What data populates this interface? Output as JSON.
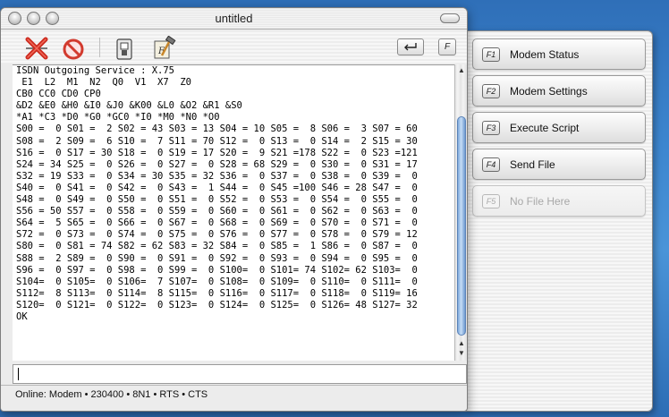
{
  "window": {
    "title": "untitled",
    "toolbar": {
      "disconnect_icon": "red-x-disconnect-icon",
      "stop_icon": "no-entry-icon",
      "settings_icon": "switch-icon",
      "script_icon": "hammer-script-icon",
      "return_icon": "return-arrow-icon",
      "function_key_label": "F"
    },
    "terminal_lines": [
      "ISDN Outgoing Service : X.75",
      " E1  L2  M1  N2  Q0  V1  X7  Z0",
      "CB0 CC0 CD0 CP0",
      "&D2 &E0 &H0 &I0 &J0 &K00 &L0 &O2 &R1 &S0",
      "*A1 *C3 *D0 *G0 *GC0 *I0 *M0 *N0 *O0",
      "S00 =  0 S01 =  2 S02 = 43 S03 = 13 S04 = 10 S05 =  8 S06 =  3 S07 = 60",
      "S08 =  2 S09 =  6 S10 =  7 S11 = 70 S12 =  0 S13 =  0 S14 =  2 S15 = 30",
      "S16 =  0 S17 = 30 S18 =  0 S19 = 17 S20 =  9 S21 =178 S22 =  0 S23 =121",
      "S24 = 34 S25 =  0 S26 =  0 S27 =  0 S28 = 68 S29 =  0 S30 =  0 S31 = 17",
      "S32 = 19 S33 =  0 S34 = 30 S35 = 32 S36 =  0 S37 =  0 S38 =  0 S39 =  0",
      "S40 =  0 S41 =  0 S42 =  0 S43 =  1 S44 =  0 S45 =100 S46 = 28 S47 =  0",
      "S48 =  0 S49 =  0 S50 =  0 S51 =  0 S52 =  0 S53 =  0 S54 =  0 S55 =  0",
      "S56 = 50 S57 =  0 S58 =  0 S59 =  0 S60 =  0 S61 =  0 S62 =  0 S63 =  0",
      "S64 =  5 S65 =  0 S66 =  0 S67 =  0 S68 =  0 S69 =  0 S70 =  0 S71 =  0",
      "S72 =  0 S73 =  0 S74 =  0 S75 =  0 S76 =  0 S77 =  0 S78 =  0 S79 = 12",
      "S80 =  0 S81 = 74 S82 = 62 S83 = 32 S84 =  0 S85 =  1 S86 =  0 S87 =  0",
      "S88 =  2 S89 =  0 S90 =  0 S91 =  0 S92 =  0 S93 =  0 S94 =  0 S95 =  0",
      "S96 =  0 S97 =  0 S98 =  0 S99 =  0 S100=  0 S101= 74 S102= 62 S103=  0",
      "S104=  0 S105=  0 S106=  7 S107=  0 S108=  0 S109=  0 S110=  0 S111=  0",
      "S112=  8 S113=  0 S114=  8 S115=  0 S116=  0 S117=  0 S118=  0 S119= 16",
      "S120=  0 S121=  0 S122=  0 S123=  0 S124=  0 S125=  0 S126= 48 S127= 32",
      "OK"
    ],
    "input_value": "",
    "status": "Online: Modem • 230400 • 8N1 • RTS • CTS"
  },
  "drawer": {
    "buttons": [
      {
        "key": "F1",
        "label": "Modem Status",
        "enabled": true
      },
      {
        "key": "F2",
        "label": "Modem Settings",
        "enabled": true
      },
      {
        "key": "F3",
        "label": "Execute Script",
        "enabled": true
      },
      {
        "key": "F4",
        "label": "Send File",
        "enabled": true
      },
      {
        "key": "F5",
        "label": "No File Here",
        "enabled": false
      }
    ]
  },
  "colors": {
    "desktop": "#3d86cf",
    "disconnect_red": "#cc2a1e",
    "scroll_thumb": "#7fa9dc"
  }
}
